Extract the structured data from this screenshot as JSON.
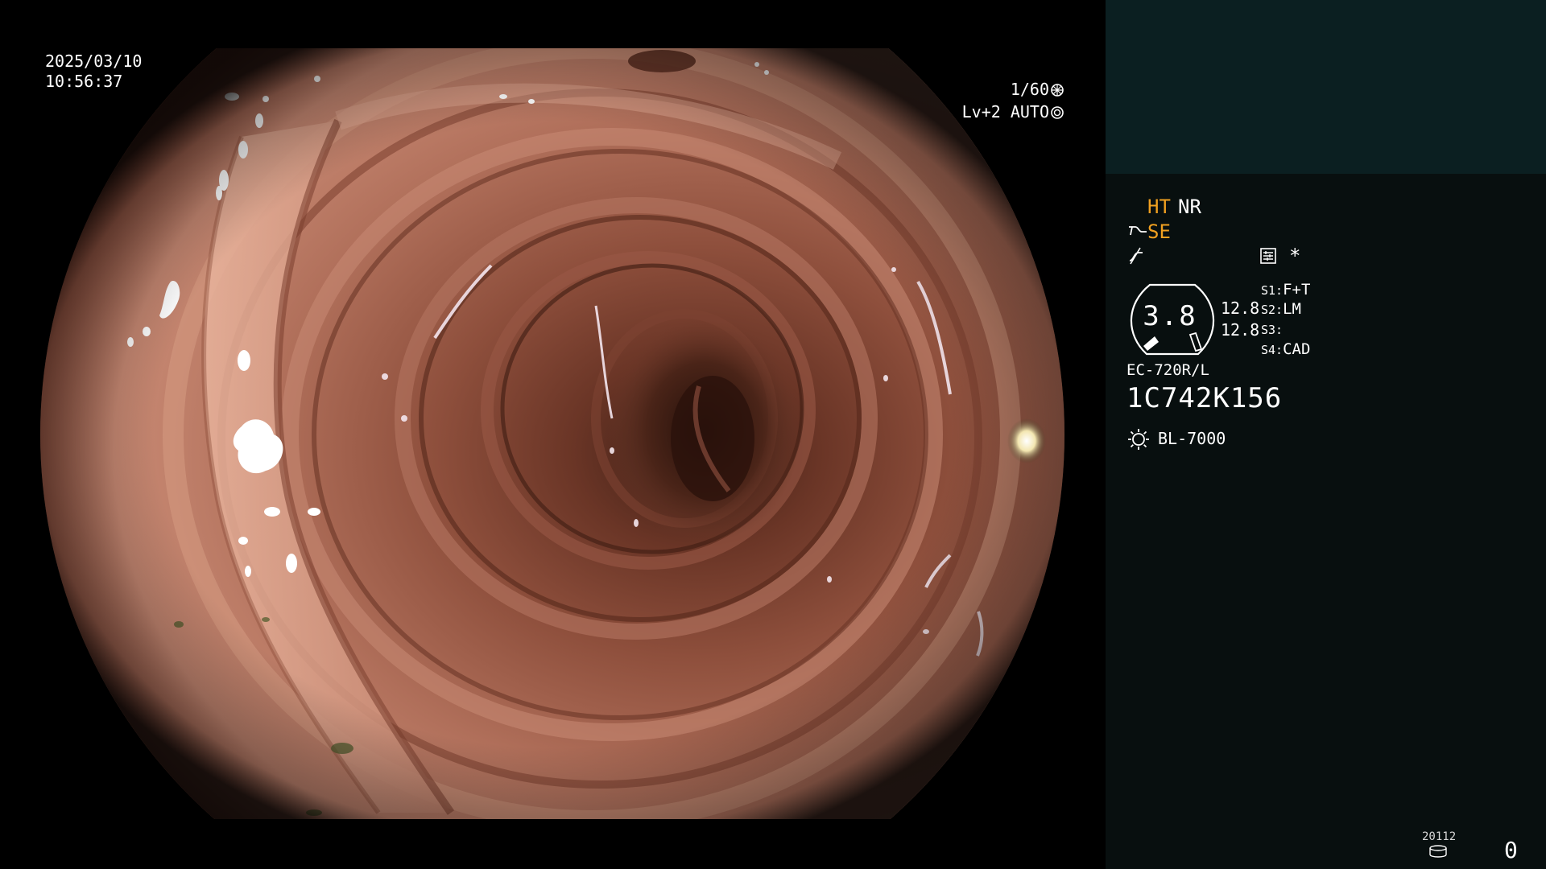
{
  "overlay": {
    "date": "2025/03/10",
    "time": "10:56:37",
    "shutter": "1/60",
    "shutter_icon": "shutter-icon",
    "level": "Lv+2",
    "mode": "AUTO",
    "mode_icon": "iris-icon"
  },
  "panel": {
    "ht": "HT",
    "nr": "NR",
    "se": "SE",
    "se_icon": "structure-enhance-icon",
    "fcut_icon": "noise-filter-icon",
    "setting_icon": "settings-list-icon",
    "asterisk": "*",
    "gauge": {
      "value": "3.8",
      "side_1": "12.8",
      "side_2": "12.8"
    },
    "switches": [
      {
        "key": "S1:",
        "value": "F+T"
      },
      {
        "key": "S2:",
        "value": "LM"
      },
      {
        "key": "S3:",
        "value": ""
      },
      {
        "key": "S4:",
        "value": "CAD"
      }
    ],
    "scope_model": "EC-720R/L",
    "serial": "1C742K156",
    "light_icon": "light-source-icon",
    "light_source": "BL-7000",
    "counter_small": "20112",
    "disk_icon": "storage-icon",
    "counter_big": "0"
  },
  "colors": {
    "background": "#000000",
    "panel_bg": "#080f0f",
    "panel_top": "#0b1f21",
    "text": "#ffffff",
    "highlight": "#f0a020",
    "mucosa": "#c48670"
  }
}
